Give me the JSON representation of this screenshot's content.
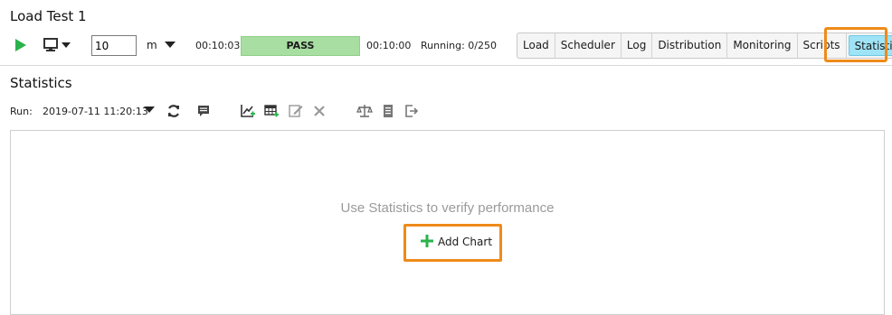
{
  "window": {
    "title": "Load Test 1"
  },
  "toolbar": {
    "duration_value": "10",
    "duration_unit": "m",
    "elapsed_time": "00:10:03",
    "status": "PASS",
    "status_color": "#a8dea2",
    "total_time": "00:10:00",
    "running": "Running: 0/250"
  },
  "tabs": [
    {
      "label": "Load"
    },
    {
      "label": "Scheduler"
    },
    {
      "label": "Log"
    },
    {
      "label": "Distribution"
    },
    {
      "label": "Monitoring"
    },
    {
      "label": "Scripts"
    },
    {
      "label": "Statistics",
      "active": true
    }
  ],
  "statistics": {
    "title": "Statistics",
    "run_label": "Run:",
    "run_value": "2019-07-11 11:20:13",
    "empty_message": "Use Statistics to verify performance",
    "add_chart_label": "Add Chart"
  },
  "icons": {
    "play": "play-icon",
    "monitor": "monitor-icon",
    "refresh": "refresh-icon",
    "comment": "comment-icon",
    "add_chart": "add-chart-icon",
    "add_table": "add-table-icon",
    "edit": "edit-icon",
    "delete": "delete-icon",
    "compare": "compare-icon",
    "report": "report-icon",
    "export": "export-icon"
  },
  "colors": {
    "highlight": "#ef8a1a",
    "active_tab": "#9fe3f6",
    "play_green": "#2bb24c",
    "plus_green": "#2bb24c"
  }
}
